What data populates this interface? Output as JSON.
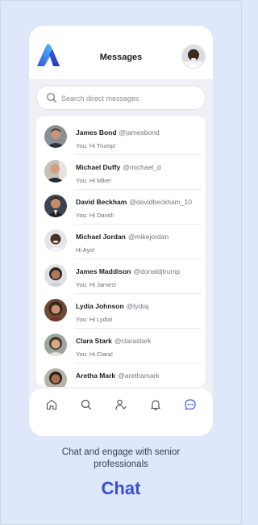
{
  "header": {
    "title": "Messages",
    "logo_icon": "brand-a-logo",
    "brand_color": "#3e5af0"
  },
  "search": {
    "placeholder": "Search direct messages"
  },
  "conversations": [
    {
      "name": "James Bond",
      "handle": "@jamesbond",
      "preview": "You: Hi Trump!"
    },
    {
      "name": "Michael Duffy",
      "handle": "@michael_d",
      "preview": "You: Hi Mike!"
    },
    {
      "name": "David Beckham",
      "handle": "@davidbeckham_10",
      "preview": "You: Hi David!"
    },
    {
      "name": "Michael Jordan",
      "handle": "@mikejordan",
      "preview": "Hi Ayo!"
    },
    {
      "name": "James Maddison",
      "handle": "@donaldjtrump",
      "preview": "You: Hi James!"
    },
    {
      "name": "Lydia Johnson",
      "handle": "@lydiaj",
      "preview": "You: Hi Lydia!"
    },
    {
      "name": "Clara Stark",
      "handle": "@clarastark",
      "preview": "You: Hi Clara!"
    },
    {
      "name": "Aretha Mark",
      "handle": "@arethamark",
      "preview": ""
    }
  ],
  "tabbar": {
    "items": [
      "home-icon",
      "search-icon",
      "people-icon",
      "bell-icon",
      "chat-icon"
    ],
    "active": "chat-icon",
    "active_color": "#3e5af0",
    "inactive_color": "#4a4c55"
  },
  "promo": {
    "caption_line1": "Chat and engage with senior",
    "caption_line2": "professionals",
    "headline": "Chat"
  }
}
